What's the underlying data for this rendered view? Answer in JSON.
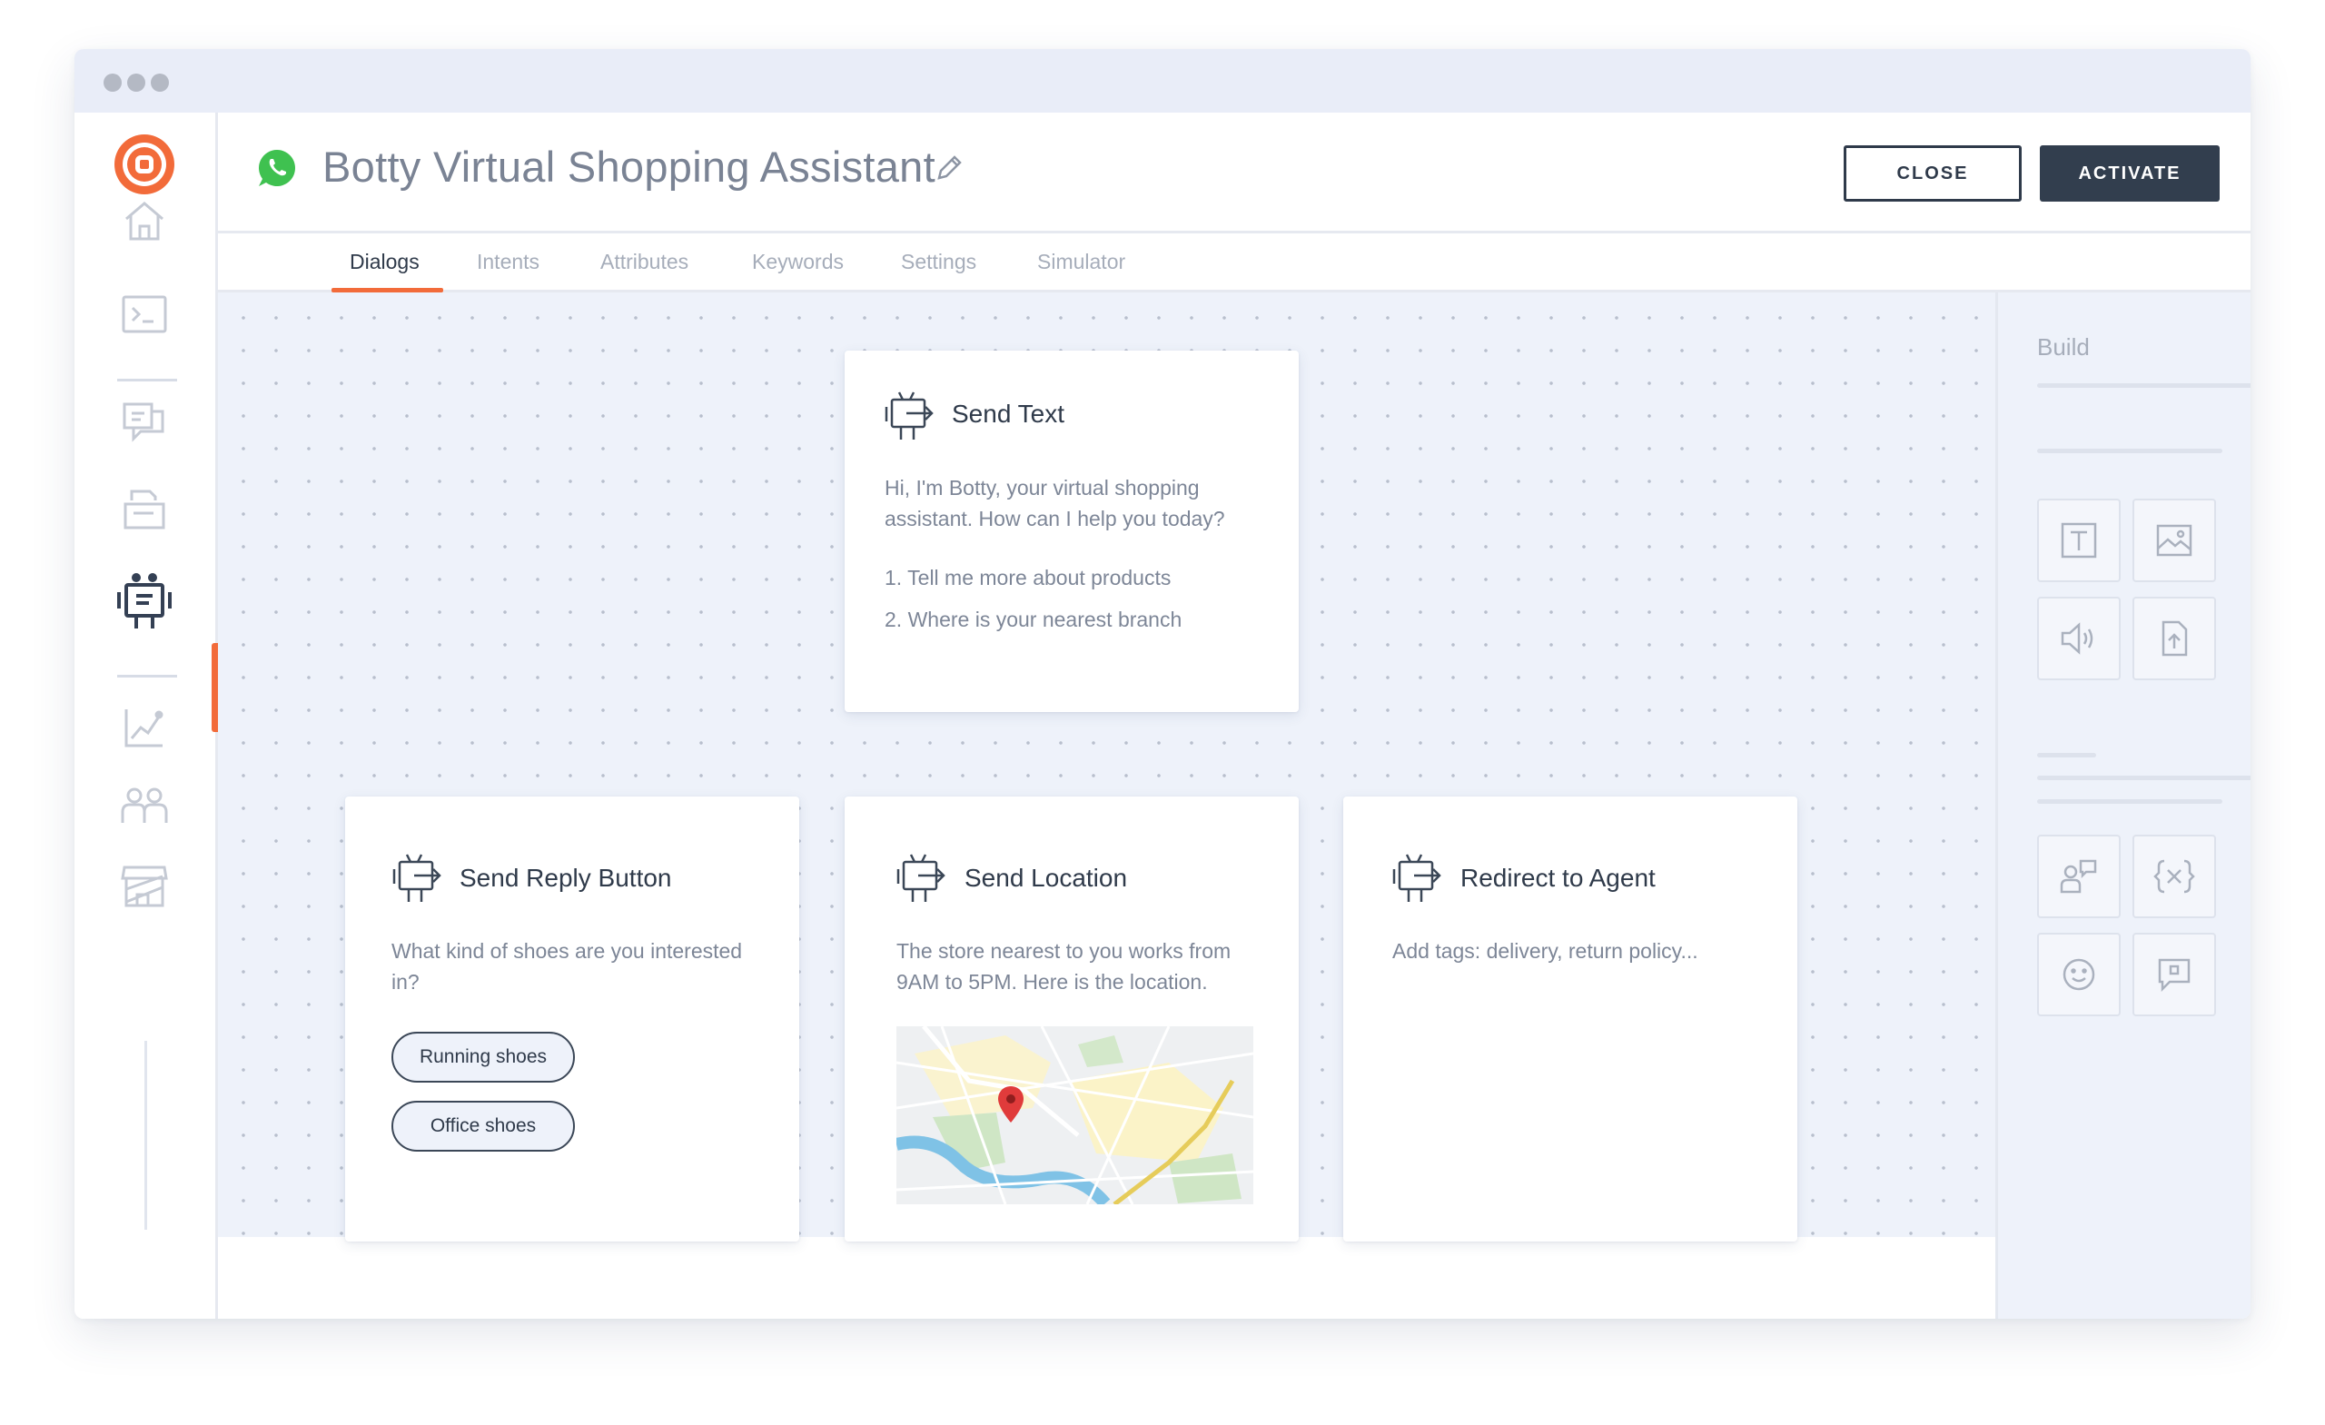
{
  "window": {
    "controls": [
      "close",
      "minimize",
      "maximize"
    ]
  },
  "sidebar": {
    "logo_icon": "target-logo-icon",
    "items": [
      {
        "name": "home",
        "icon": "home-icon"
      },
      {
        "name": "terminal",
        "icon": "terminal-icon"
      },
      {
        "name": "conversations",
        "icon": "chat-bubbles-icon"
      },
      {
        "name": "templates",
        "icon": "stacked-documents-icon"
      },
      {
        "name": "chatbots",
        "icon": "robot-icon",
        "active": true
      },
      {
        "name": "analytics",
        "icon": "line-chart-icon"
      },
      {
        "name": "people",
        "icon": "people-icon"
      },
      {
        "name": "store",
        "icon": "store-icon"
      }
    ],
    "accent_color": "#f26b3a"
  },
  "header": {
    "channel_icon": "whatsapp-icon",
    "title": "Botty Virtual Shopping Assistant",
    "close_label": "CLOSE",
    "activate_label": "ACTIVATE"
  },
  "tabs": [
    {
      "label": "Dialogs",
      "active": true
    },
    {
      "label": "Intents"
    },
    {
      "label": "Attributes"
    },
    {
      "label": "Keywords"
    },
    {
      "label": "Settings"
    },
    {
      "label": "Simulator"
    }
  ],
  "cards": {
    "send_text": {
      "title": "Send Text",
      "text": "Hi, I'm Botty, your virtual shopping assistant. How can I help you today?",
      "items": [
        "1.  Tell me more about products",
        "2.  Where is your nearest branch"
      ]
    },
    "send_reply_button": {
      "title": "Send Reply Button",
      "text": "What kind of shoes are you interested in?",
      "buttons": [
        "Running shoes",
        "Office shoes"
      ]
    },
    "send_location": {
      "title": "Send Location",
      "text": "The store nearest to you works from 9AM to 5PM. Here is the location.",
      "map_icon": "map-pin-icon"
    },
    "redirect_to_agent": {
      "title": "Redirect to Agent",
      "text": "Add tags: delivery, return policy..."
    }
  },
  "build_panel": {
    "title": "Build",
    "tools": [
      {
        "name": "text",
        "icon": "text-icon"
      },
      {
        "name": "image",
        "icon": "image-icon"
      },
      {
        "name": "audio",
        "icon": "speaker-icon"
      },
      {
        "name": "document",
        "icon": "file-upload-icon"
      },
      {
        "name": "agent",
        "icon": "agent-icon"
      },
      {
        "name": "variable",
        "icon": "variable-icon"
      },
      {
        "name": "emoji",
        "icon": "emoji-icon"
      },
      {
        "name": "message",
        "icon": "message-icon"
      }
    ]
  }
}
